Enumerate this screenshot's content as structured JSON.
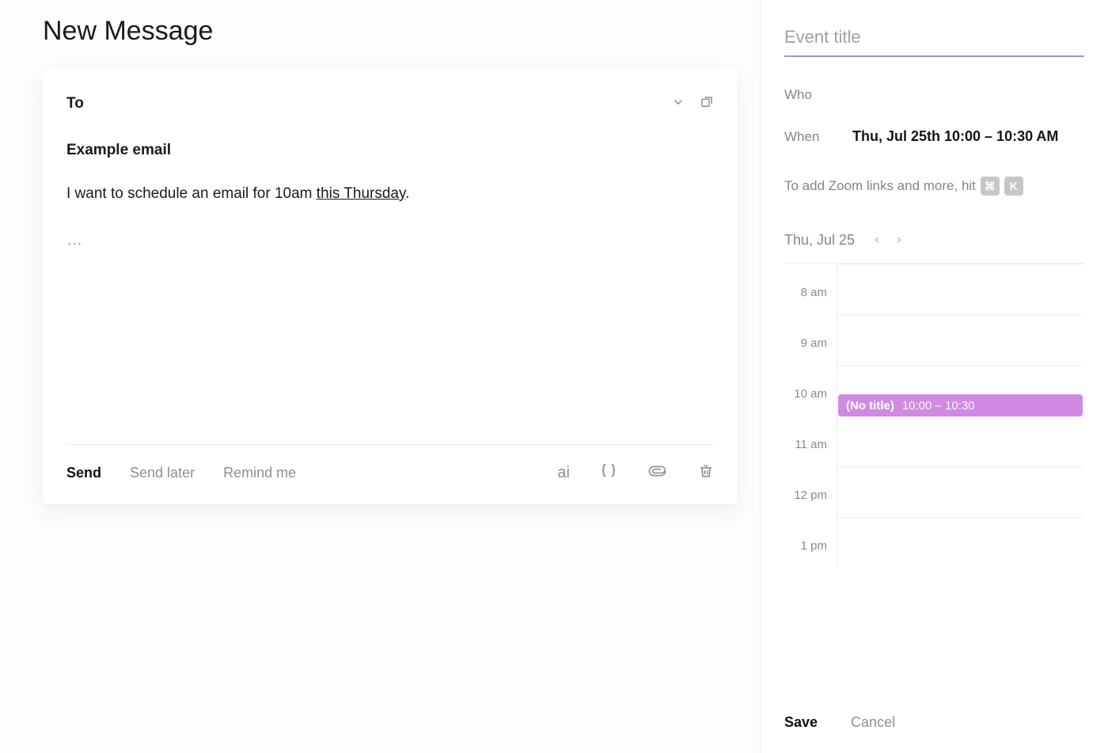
{
  "compose": {
    "title": "New Message",
    "to_label": "To",
    "subject": "Example email",
    "body_prefix": "I want to schedule an email for 10am ",
    "body_highlight": "this Thursday",
    "body_suffix": ".",
    "signature_marker": "…",
    "toolbar": {
      "send": "Send",
      "send_later": "Send later",
      "remind_me": "Remind me",
      "ai_label": "ai"
    },
    "icons": {
      "cc_bcc": "chevron-down-icon",
      "popout": "popout-icon",
      "ai": "ai-icon",
      "template": "braces-icon",
      "attach": "paperclip-icon",
      "discard": "trash-icon"
    }
  },
  "event": {
    "title_placeholder": "Event title",
    "who_label": "Who",
    "when_label": "When",
    "when_value": "Thu, Jul 25th 10:00 – 10:30 AM",
    "hint_text": "To add Zoom links and more, hit",
    "hint_keys": [
      "⌘",
      "K"
    ],
    "calendar": {
      "date_label": "Thu, Jul 25",
      "hours": [
        "8 am",
        "9 am",
        "10 am",
        "11 am",
        "12 pm",
        "1 pm"
      ],
      "event_chip": {
        "title": "(No title)",
        "time": "10:00 – 10:30",
        "hour_index": 2,
        "color": "#d18ae3"
      }
    },
    "footer": {
      "save": "Save",
      "cancel": "Cancel"
    }
  }
}
